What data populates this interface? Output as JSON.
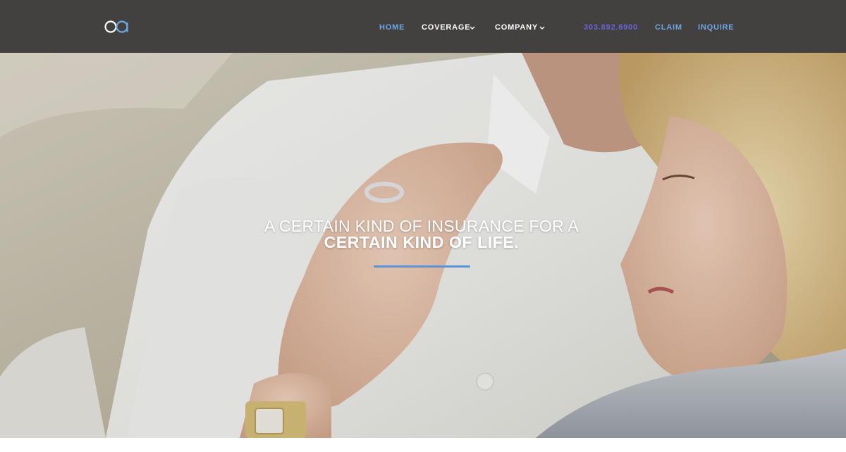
{
  "brand": {
    "logo_icon": "oa-logo-icon",
    "logo_color": "#ffffff",
    "logo_accent": "#6ea6e4"
  },
  "nav": {
    "home": "HOME",
    "coverage": "COVERAGE",
    "company": "COMPANY",
    "phone": "303.892.6900",
    "claim": "CLAIM",
    "inquire": "INQUIRE",
    "dropdown_icon": "chevron-down-icon"
  },
  "hero": {
    "line1": "A CERTAIN KIND OF INSURANCE FOR A",
    "line2": "CERTAIN KIND OF LIFE.",
    "image": "couple-embracing-photo"
  },
  "colors": {
    "navbar_bg": "#434140",
    "accent_blue": "#6ea6e4",
    "phone_purple": "#6c63d8",
    "divider_blue": "#5b93d6"
  }
}
